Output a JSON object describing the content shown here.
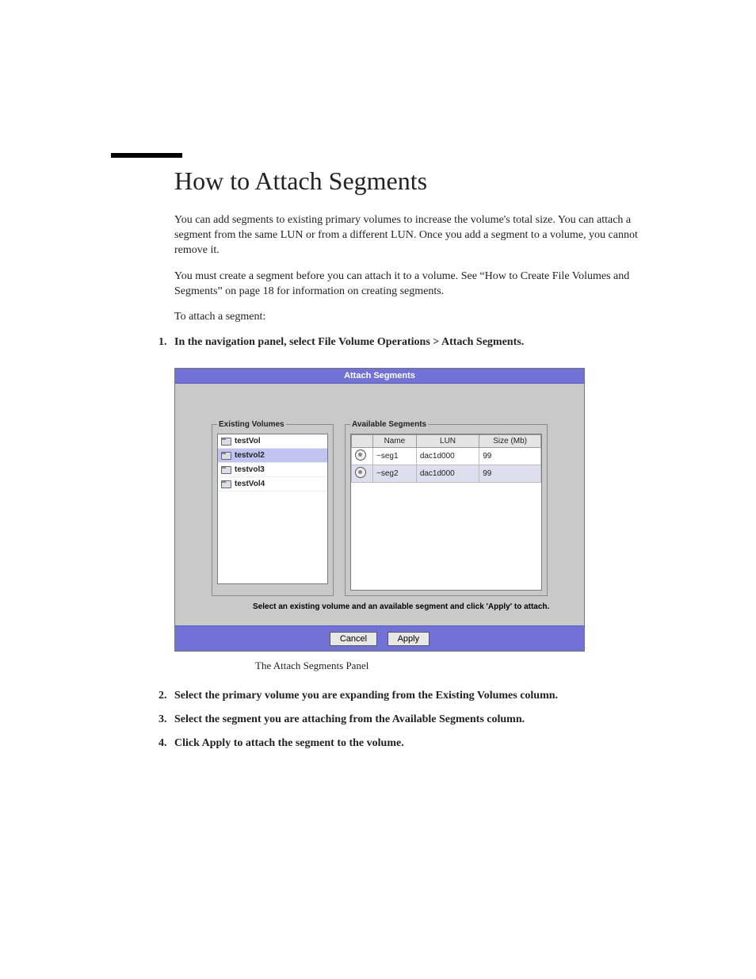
{
  "title": "How to Attach Segments",
  "para1": "You can add segments to existing primary volumes to increase the volume's total size. You can attach a segment from the same LUN or from a different LUN. Once you add a segment to a volume, you cannot remove it.",
  "para2": "You must create a segment before you can attach it to a volume. See “How to Create File Volumes and Segments” on page 18 for information on creating segments.",
  "para3": "To attach a segment:",
  "step1": "In the navigation panel, select File Volume Operations > Attach Segments.",
  "panel": {
    "title": "Attach Segments",
    "existingLegend": "Existing Volumes",
    "availableLegend": "Available Segments",
    "hint": "Select an existing volume and an available segment and click 'Apply' to attach.",
    "cols": {
      "name": "Name",
      "lun": "LUN",
      "size": "Size (Mb)"
    },
    "volumes": [
      {
        "label": "testVol",
        "selected": false
      },
      {
        "label": "testvol2",
        "selected": true
      },
      {
        "label": "testvol3",
        "selected": false
      },
      {
        "label": "testVol4",
        "selected": false
      }
    ],
    "segments": [
      {
        "name": "~seg1",
        "lun": "dac1d000",
        "size": "99",
        "alt": false
      },
      {
        "name": "~seg2",
        "lun": "dac1d000",
        "size": "99",
        "alt": true
      }
    ],
    "buttons": {
      "cancel": "Cancel",
      "apply": "Apply"
    }
  },
  "caption": "The Attach Segments Panel",
  "step2": "Select the primary volume you are expanding from the Existing Volumes column.",
  "step3": "Select the segment you are attaching from the Available Segments column.",
  "step4": "Click Apply to attach the segment to the volume."
}
